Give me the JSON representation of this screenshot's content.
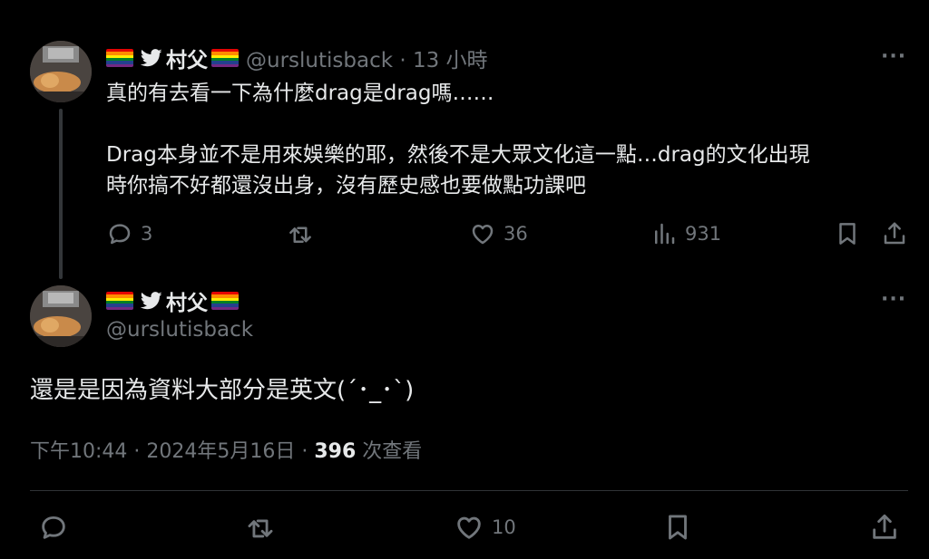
{
  "tweet1": {
    "display_name": "村父",
    "handle_time": "@urslutisback · 13 小時",
    "text": "真的有去看一下為什麼drag是drag嗎……\n\nDrag本身並不是用來娛樂的耶，然後不是大眾文化這一點…drag的文化出現\n時你搞不好都還沒出身，沒有歷史感也要做點功課吧",
    "replies": "3",
    "likes": "36",
    "views": "931",
    "more": "···"
  },
  "tweet2": {
    "display_name": "村父",
    "handle": "@urslutisback",
    "text": "還是是因為資料大部分是英文(´･_･`)",
    "timestamp": "下午10:44 · 2024年5月16日 · ",
    "view_count": "396",
    "view_label": " 次查看",
    "likes": "10",
    "more": "···"
  },
  "colors": {
    "background": "#000000",
    "text": "#e7e9ea",
    "muted": "#71767b",
    "divider": "#2f3336"
  },
  "icons": [
    "rainbow-flag-icon",
    "bird-icon",
    "reply-icon",
    "retweet-icon",
    "like-icon",
    "views-icon",
    "bookmark-icon",
    "share-icon",
    "more-icon"
  ]
}
